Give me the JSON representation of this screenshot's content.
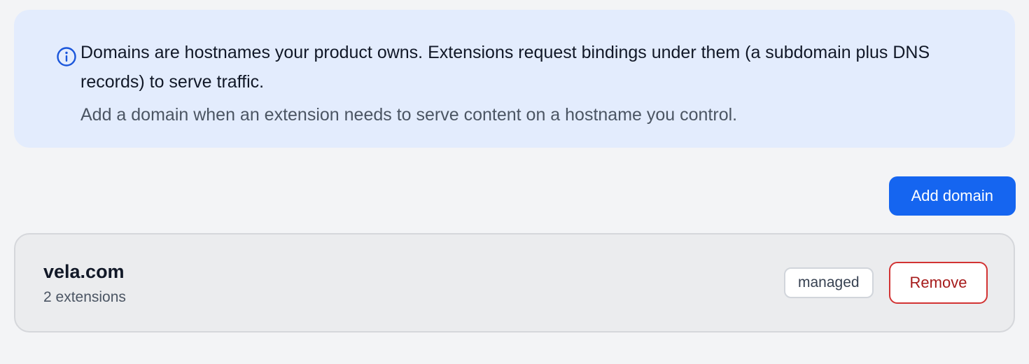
{
  "info_banner": {
    "icon": "info-icon",
    "primary_text": "Domains are hostnames your product owns. Extensions request bindings under them (a subdomain plus DNS records) to serve traffic.",
    "secondary_text": "Add a domain when an extension needs to serve content on a hostname you control."
  },
  "toolbar": {
    "add_domain_label": "Add domain"
  },
  "domains": [
    {
      "name": "vela.com",
      "meta": "2 extensions",
      "badge": "managed",
      "remove_label": "Remove"
    }
  ],
  "colors": {
    "accent": "#1565f0",
    "banner_background": "#e3ecfd",
    "danger": "#d23333"
  }
}
